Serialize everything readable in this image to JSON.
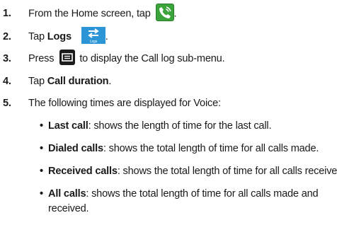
{
  "steps": [
    {
      "number": "1.",
      "text_before": "From the Home screen, tap",
      "text_after": ".",
      "icon": "phone-icon"
    },
    {
      "number": "2.",
      "text_before": "Tap",
      "bold": "Logs",
      "icon": "logs-icon",
      "icon_label": "Logs",
      "text_after": "."
    },
    {
      "number": "3.",
      "text_before": "Press",
      "icon": "menu-icon",
      "text_after": "to display the Call log sub-menu."
    },
    {
      "number": "4.",
      "text_before": "Tap",
      "bold": "Call duration",
      "text_after": "."
    },
    {
      "number": "5.",
      "text": "The following times are displayed for Voice:"
    }
  ],
  "bullets": [
    {
      "bold": "Last call",
      "text": ": shows the length of time for the last call."
    },
    {
      "bold": "Dialed calls",
      "text": ": shows the total length of time for all calls made."
    },
    {
      "bold": "Received calls",
      "text": ": shows the total length of time for all calls received."
    },
    {
      "bold": "All calls",
      "text": ": shows the total length of time for all calls made and",
      "continuation": "received."
    }
  ],
  "colors": {
    "phone_icon": "#3aa43a",
    "logs_icon": "#2c95d6",
    "menu_icon": "#1c1c1c"
  }
}
